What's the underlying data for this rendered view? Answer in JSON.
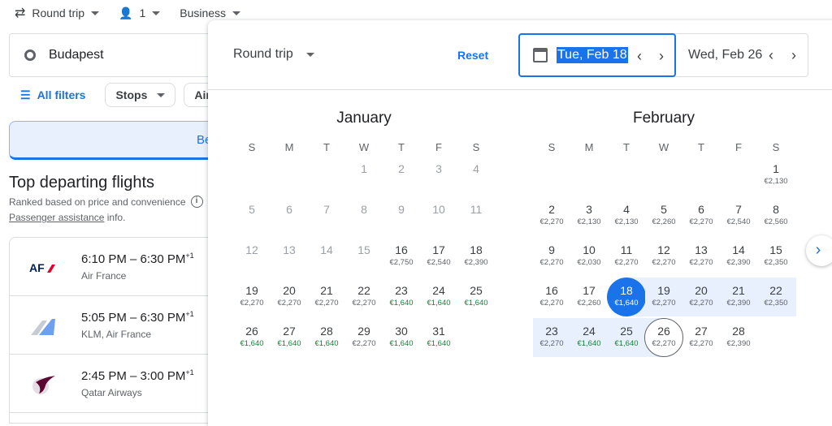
{
  "topbar": {
    "trip_type": "Round trip",
    "passengers": "1",
    "cabin": "Business"
  },
  "search": {
    "origin": "Budapest"
  },
  "filters": {
    "all_filters": "All filters",
    "stops": "Stops",
    "airlines": "Airlir"
  },
  "banner": {
    "text": "Be"
  },
  "results": {
    "title": "Top departing flights",
    "subtitle": "Ranked based on price and convenience",
    "assist_link": "Passenger assistance",
    "assist_suffix": " info.",
    "flights": [
      {
        "time": "6:10 PM – 6:30 PM",
        "plus": "+1",
        "airline": "Air France",
        "logo": "air-france-logo"
      },
      {
        "time": "5:05 PM – 6:30 PM",
        "plus": "+1",
        "airline": "KLM, Air France",
        "logo": "klm-logo"
      },
      {
        "time": "2:45 PM – 3:00 PM",
        "plus": "+1",
        "airline": "Qatar Airways",
        "logo": "qatar-logo"
      }
    ]
  },
  "picker": {
    "trip_type": "Round trip",
    "reset": "Reset",
    "departure": "Tue, Feb 18",
    "return": "Wed, Feb 26",
    "weekdays": [
      "S",
      "M",
      "T",
      "W",
      "T",
      "F",
      "S"
    ],
    "months": [
      {
        "name": "January",
        "offset": 3,
        "days": [
          {
            "d": "1",
            "dis": true
          },
          {
            "d": "2",
            "dis": true
          },
          {
            "d": "3",
            "dis": true
          },
          {
            "d": "4",
            "dis": true
          },
          {
            "d": "5",
            "dis": true
          },
          {
            "d": "6",
            "dis": true
          },
          {
            "d": "7",
            "dis": true
          },
          {
            "d": "8",
            "dis": true
          },
          {
            "d": "9",
            "dis": true
          },
          {
            "d": "10",
            "dis": true
          },
          {
            "d": "11",
            "dis": true
          },
          {
            "d": "12",
            "dis": true
          },
          {
            "d": "13",
            "dis": true
          },
          {
            "d": "14",
            "dis": true
          },
          {
            "d": "15",
            "dis": true
          },
          {
            "d": "16",
            "p": "€2,750"
          },
          {
            "d": "17",
            "p": "€2,540"
          },
          {
            "d": "18",
            "p": "€2,390"
          },
          {
            "d": "19",
            "p": "€2,270"
          },
          {
            "d": "20",
            "p": "€2,270"
          },
          {
            "d": "21",
            "p": "€2,270"
          },
          {
            "d": "22",
            "p": "€2,270"
          },
          {
            "d": "23",
            "p": "€1,640",
            "deal": true
          },
          {
            "d": "24",
            "p": "€1,640",
            "deal": true
          },
          {
            "d": "25",
            "p": "€1,640",
            "deal": true
          },
          {
            "d": "26",
            "p": "€1,640",
            "deal": true
          },
          {
            "d": "27",
            "p": "€1,640",
            "deal": true
          },
          {
            "d": "28",
            "p": "€1,640",
            "deal": true
          },
          {
            "d": "29",
            "p": "€2,270"
          },
          {
            "d": "30",
            "p": "€1,640",
            "deal": true
          },
          {
            "d": "31",
            "p": "€1,640",
            "deal": true
          }
        ]
      },
      {
        "name": "February",
        "offset": 6,
        "days": [
          {
            "d": "1",
            "p": "€2,130"
          },
          {
            "d": "2",
            "p": "€2,270"
          },
          {
            "d": "3",
            "p": "€2,130"
          },
          {
            "d": "4",
            "p": "€2,130"
          },
          {
            "d": "5",
            "p": "€2,260"
          },
          {
            "d": "6",
            "p": "€2,270"
          },
          {
            "d": "7",
            "p": "€2,540"
          },
          {
            "d": "8",
            "p": "€2,560"
          },
          {
            "d": "9",
            "p": "€2,270"
          },
          {
            "d": "10",
            "p": "€2,030"
          },
          {
            "d": "11",
            "p": "€2,270"
          },
          {
            "d": "12",
            "p": "€2,270"
          },
          {
            "d": "13",
            "p": "€2,270"
          },
          {
            "d": "14",
            "p": "€2,390"
          },
          {
            "d": "15",
            "p": "€2,350"
          },
          {
            "d": "16",
            "p": "€2,270"
          },
          {
            "d": "17",
            "p": "€2,260"
          },
          {
            "d": "18",
            "p": "€1,640",
            "sel": "start"
          },
          {
            "d": "19",
            "p": "€2,270",
            "inrange": true
          },
          {
            "d": "20",
            "p": "€2,270",
            "inrange": true
          },
          {
            "d": "21",
            "p": "€2,390",
            "inrange": true
          },
          {
            "d": "22",
            "p": "€2,350",
            "inrange": true
          },
          {
            "d": "23",
            "p": "€2,270",
            "inrange": true
          },
          {
            "d": "24",
            "p": "€1,640",
            "deal": true,
            "inrange": true
          },
          {
            "d": "25",
            "p": "€1,640",
            "deal": true,
            "inrange": true
          },
          {
            "d": "26",
            "p": "€2,270",
            "sel": "end"
          },
          {
            "d": "27",
            "p": "€2,270"
          },
          {
            "d": "28",
            "p": "€2,390"
          }
        ]
      }
    ]
  },
  "colors": {
    "accent": "#1a73e8",
    "deal": "#188038",
    "range": "#e8f0fe"
  }
}
